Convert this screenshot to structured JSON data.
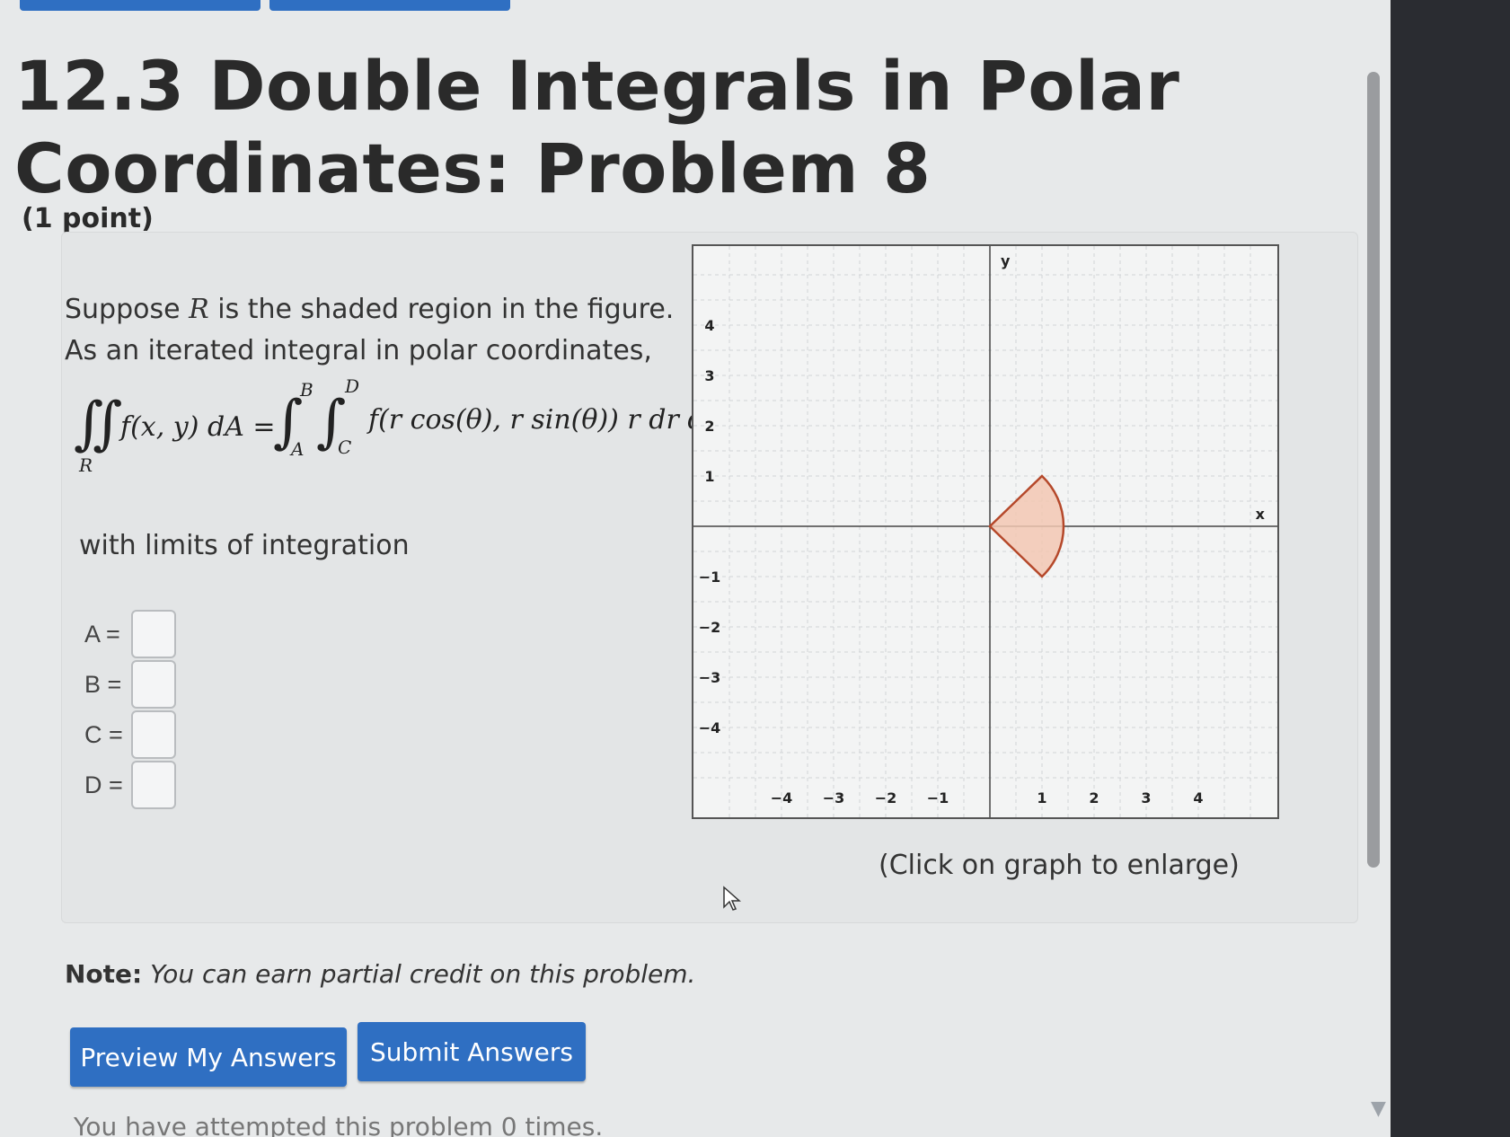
{
  "title": "12.3 Double Integrals in Polar Coordinates: Problem 8",
  "points": "(1 point)",
  "statement": {
    "prefix": "Suppose ",
    "var": "R",
    "suffix": " is the shaded region in the figure. As an iterated integral in polar coordinates,"
  },
  "formula": {
    "lhs_region": "R",
    "lhs_expr": "f(x, y) dA =",
    "outer_upper": "B",
    "outer_lower": "A",
    "inner_upper": "D",
    "inner_lower": "C",
    "integrand": "f(r cos(θ), r sin(θ)) r dr dθ"
  },
  "limits_label": "with limits of integration",
  "answers": [
    {
      "label": "A =",
      "value": ""
    },
    {
      "label": "B =",
      "value": ""
    },
    {
      "label": "C =",
      "value": ""
    },
    {
      "label": "D =",
      "value": ""
    }
  ],
  "chart_data": {
    "type": "region",
    "xlabel": "x",
    "ylabel": "y",
    "xlim": [
      -5,
      5
    ],
    "ylim": [
      -5,
      5
    ],
    "x_ticks": [
      -4,
      -3,
      -2,
      -1,
      1,
      2,
      3,
      4
    ],
    "y_ticks": [
      4,
      3,
      2,
      1,
      -1,
      -2,
      -3,
      -4
    ],
    "grid": true,
    "shaded_region": {
      "shape": "sector",
      "r_max": 1.414,
      "theta_start_deg": -45,
      "theta_end_deg": 45,
      "fill": "#f2c7b3",
      "stroke": "#b5482a"
    }
  },
  "graph_caption": "(Click on graph to enlarge)",
  "note": {
    "bold": "Note:",
    "text": "You can earn partial credit on this problem."
  },
  "buttons": {
    "preview": "Preview My Answers",
    "submit": "Submit Answers"
  },
  "attempts": "You have attempted this problem 0 times."
}
